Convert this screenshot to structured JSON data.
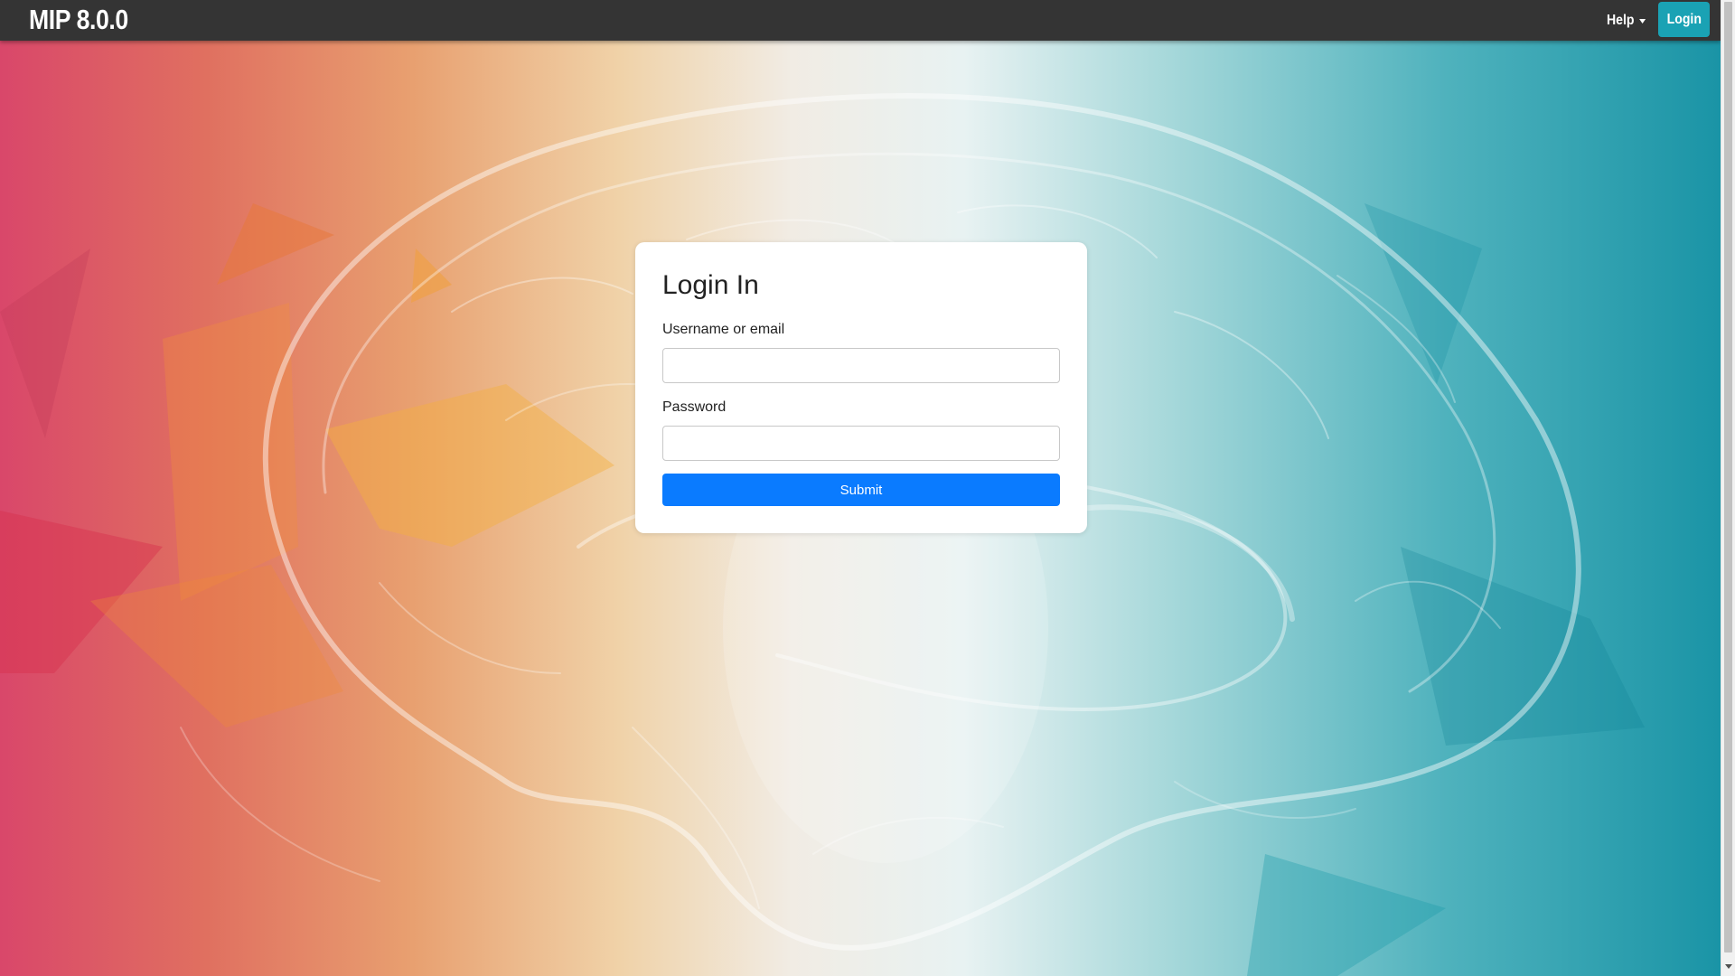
{
  "navbar": {
    "brand": "MIP 8.0.0",
    "help_label": "Help",
    "login_label": "Login"
  },
  "login_form": {
    "title": "Login In",
    "username_label": "Username or email",
    "username_value": "",
    "password_label": "Password",
    "password_value": "",
    "submit_label": "Submit"
  },
  "colors": {
    "navbar_bg": "#343434",
    "login_button_bg": "#1aa2b4",
    "submit_button_bg": "#0a7bff",
    "gradient_left": "#d9476a",
    "gradient_mid": "#f1ece4",
    "gradient_right": "#1a94a6"
  },
  "icons": {
    "help_dropdown": "caret-down-icon",
    "scroll_down": "arrow-down-icon"
  }
}
